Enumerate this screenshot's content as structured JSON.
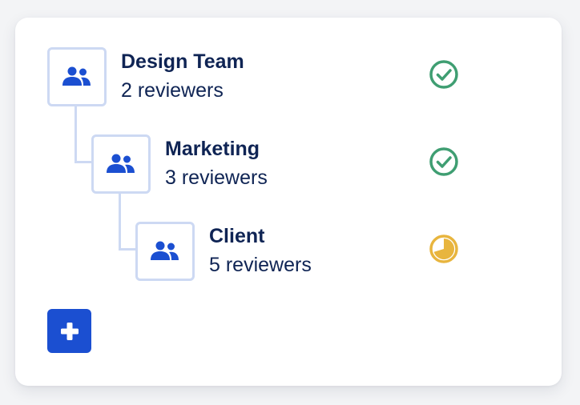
{
  "stages": [
    {
      "name": "Design Team",
      "reviewers": "2 reviewers",
      "status": "approved",
      "status_icon": "check-circle-icon"
    },
    {
      "name": "Marketing",
      "reviewers": "3 reviewers",
      "status": "approved",
      "status_icon": "check-circle-icon"
    },
    {
      "name": "Client",
      "reviewers": "5 reviewers",
      "status": "in-progress",
      "status_icon": "pie-progress-icon"
    }
  ],
  "add_button": {
    "icon": "plus-icon"
  },
  "colors": {
    "primary": "#1b4fd1",
    "text": "#0f2454",
    "border": "#cdd9f3",
    "approved": "#3f9e72",
    "pending": "#e8b53e"
  }
}
